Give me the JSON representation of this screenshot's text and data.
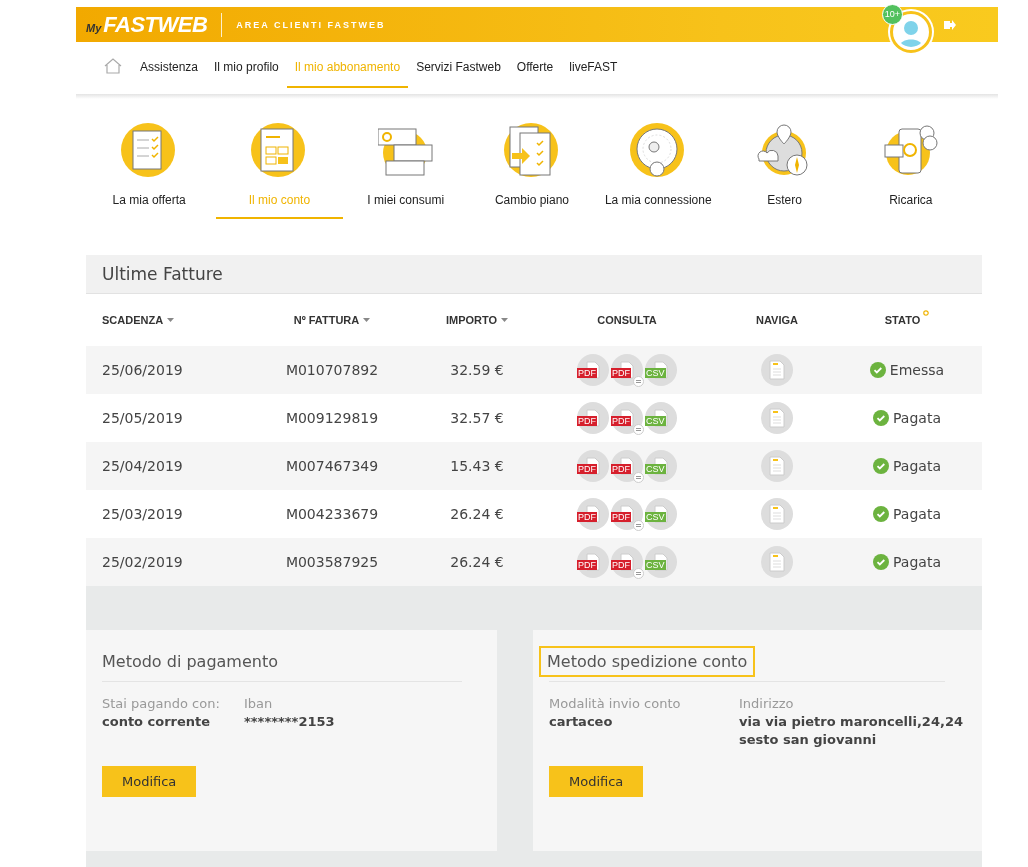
{
  "header": {
    "logo_prefix": "My",
    "logo": "FASTWEB",
    "subtitle": "AREA CLIENTI FASTWEB",
    "badge": "10+"
  },
  "nav": [
    {
      "label": "Assistenza",
      "selected": false
    },
    {
      "label": "Il mio profilo",
      "selected": false
    },
    {
      "label": "Il mio abbonamento",
      "selected": true
    },
    {
      "label": "Servizi Fastweb",
      "selected": false
    },
    {
      "label": "Offerte",
      "selected": false
    },
    {
      "label": "liveFAST",
      "selected": false
    }
  ],
  "sections": [
    {
      "label": "La mia offerta",
      "selected": false
    },
    {
      "label": "Il mio conto",
      "selected": true
    },
    {
      "label": "I miei consumi",
      "selected": false
    },
    {
      "label": "Cambio piano",
      "selected": false
    },
    {
      "label": "La mia connessione",
      "selected": false
    },
    {
      "label": "Estero",
      "selected": false
    },
    {
      "label": "Ricarica",
      "selected": false
    }
  ],
  "invoices": {
    "title": "Ultime Fatture",
    "columns": [
      {
        "label": "SCADENZA",
        "sortable": true,
        "info": false
      },
      {
        "label": "Nº FATTURA",
        "sortable": true,
        "info": false
      },
      {
        "label": "IMPORTO",
        "sortable": true,
        "info": false
      },
      {
        "label": "CONSULTA",
        "sortable": false,
        "info": false
      },
      {
        "label": "NAVIGA",
        "sortable": false,
        "info": false
      },
      {
        "label": "STATO",
        "sortable": false,
        "info": true
      }
    ],
    "rows": [
      {
        "date": "25/06/2019",
        "number": "M010707892",
        "amount": "32.59 €",
        "status": "Emessa",
        "files": [
          {
            "kind": "pdf",
            "label": "PDF"
          },
          {
            "kind": "pdf-detail",
            "label": "PDF"
          },
          {
            "kind": "csv",
            "label": "CSV"
          }
        ]
      },
      {
        "date": "25/05/2019",
        "number": "M009129819",
        "amount": "32.57 €",
        "status": "Pagata",
        "files": [
          {
            "kind": "pdf",
            "label": "PDF"
          },
          {
            "kind": "pdf-detail",
            "label": "PDF"
          },
          {
            "kind": "csv",
            "label": "CSV"
          }
        ]
      },
      {
        "date": "25/04/2019",
        "number": "M007467349",
        "amount": "15.43 €",
        "status": "Pagata",
        "files": [
          {
            "kind": "pdf",
            "label": "PDF"
          },
          {
            "kind": "pdf-detail",
            "label": "PDF"
          },
          {
            "kind": "csv",
            "label": "CSV"
          }
        ]
      },
      {
        "date": "25/03/2019",
        "number": "M004233679",
        "amount": "26.24 €",
        "status": "Pagata",
        "files": [
          {
            "kind": "pdf",
            "label": "PDF"
          },
          {
            "kind": "pdf-detail",
            "label": "PDF"
          },
          {
            "kind": "csv",
            "label": "CSV"
          }
        ]
      },
      {
        "date": "25/02/2019",
        "number": "M003587925",
        "amount": "26.24 €",
        "status": "Pagata",
        "files": [
          {
            "kind": "pdf",
            "label": "PDF"
          },
          {
            "kind": "pdf-detail",
            "label": "PDF"
          },
          {
            "kind": "csv",
            "label": "CSV"
          }
        ]
      }
    ]
  },
  "cards": [
    {
      "title": "Metodo di pagamento",
      "highlighted": false,
      "fields": [
        {
          "label": "Stai pagando con:",
          "values": [
            "conto corrente"
          ]
        },
        {
          "label": "Iban",
          "values": [
            "********2153"
          ]
        }
      ],
      "button": "Modifica"
    },
    {
      "title": "Metodo spedizione conto",
      "highlighted": true,
      "fields": [
        {
          "label": "Modalità invio conto",
          "values": [
            "cartaceo"
          ]
        },
        {
          "label": "Indirizzo",
          "values": [
            "via via pietro maroncelli,24,24",
            "sesto san giovanni"
          ]
        }
      ],
      "button": "Modifica"
    }
  ]
}
